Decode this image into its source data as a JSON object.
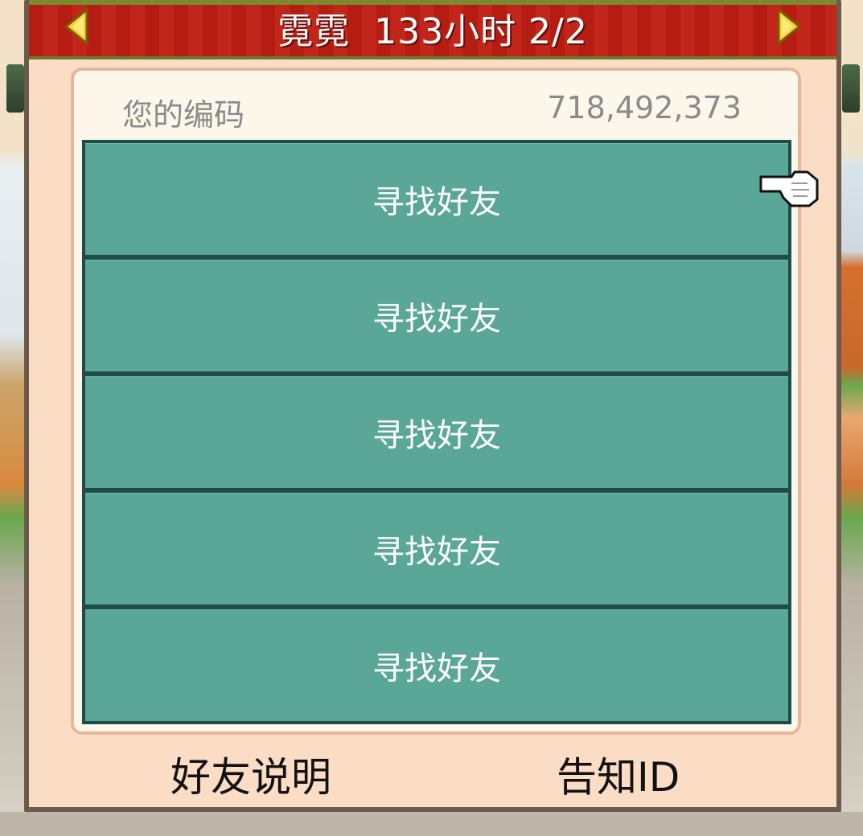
{
  "header": {
    "title": "霓霓  133小时 2/2",
    "prev_icon": "left-arrow-icon",
    "next_icon": "right-arrow-icon"
  },
  "code": {
    "label": "您的编码",
    "value": "718,492,373"
  },
  "slots": [
    {
      "label": "寻找好友"
    },
    {
      "label": "寻找好友"
    },
    {
      "label": "寻找好友"
    },
    {
      "label": "寻找好友"
    },
    {
      "label": "寻找好友"
    }
  ],
  "footer": {
    "left_label": "好友说明",
    "right_label": "告知ID"
  },
  "colors": {
    "header_red": "#b51d12",
    "slot_teal": "#5aa797",
    "panel_bg": "#fdf6ea",
    "dialog_bg": "#fbdcc4"
  }
}
